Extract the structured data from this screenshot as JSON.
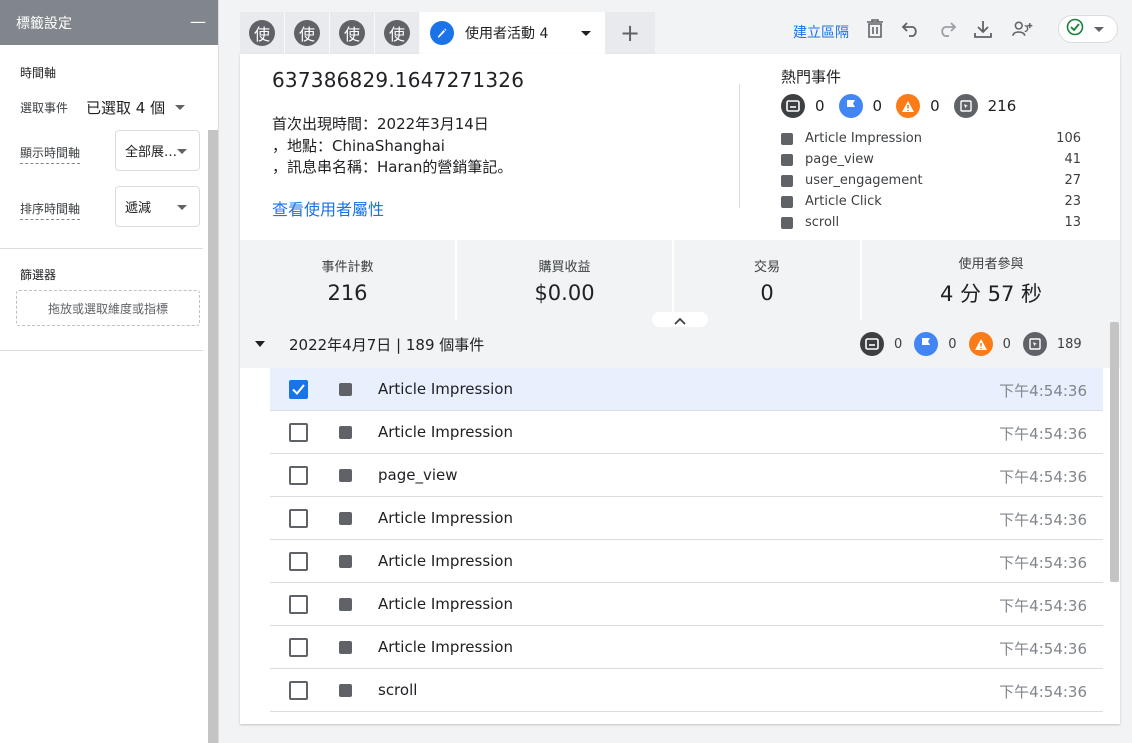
{
  "left_panel": {
    "title": "標籤設定",
    "collapse_symbol": "—",
    "timeline_section": "時間軸",
    "select_event_label": "選取事件",
    "select_event_value": "已選取 4 個",
    "display_timeline_label": "顯示時間軸",
    "display_timeline_value": "全部展…",
    "sort_timeline_label": "排序時間軸",
    "sort_timeline_value": "遞減",
    "filter_section": "篩選器",
    "filter_dropzone": "拖放或選取維度或指標"
  },
  "tabs": {
    "mini": [
      {
        "label": "使"
      },
      {
        "label": "使"
      },
      {
        "label": "使"
      },
      {
        "label": "使"
      }
    ],
    "active_label": "使用者活動 4",
    "add_symbol": "+"
  },
  "toolbar": {
    "create_segment": "建立區隔",
    "icons": [
      "delete-icon",
      "undo-icon",
      "redo-icon",
      "download-icon",
      "share-icon",
      "status-check-icon"
    ]
  },
  "user": {
    "id": "637386829.1647271326",
    "first_seen": "首次出現時間：2022年3月14日",
    "location": "，地點：ChinaShanghai",
    "stream_name": "，訊息串名稱：Haran的營銷筆記。",
    "view_properties": "查看使用者屬性"
  },
  "top_events": {
    "title": "熱門事件",
    "counts": [
      {
        "icon": "conversion-icon",
        "value": "0",
        "color": "#3c4043"
      },
      {
        "icon": "flag-icon",
        "value": "0",
        "color": "#4285f4"
      },
      {
        "icon": "warning-icon",
        "value": "0",
        "color": "#fa7b17"
      },
      {
        "icon": "event-cursor-icon",
        "value": "216",
        "color": "#5f6368"
      }
    ],
    "items": [
      {
        "name": "Article Impression",
        "count": "106"
      },
      {
        "name": "page_view",
        "count": "41"
      },
      {
        "name": "user_engagement",
        "count": "27"
      },
      {
        "name": "Article Click",
        "count": "23"
      },
      {
        "name": "scroll",
        "count": "13"
      }
    ]
  },
  "metrics": [
    {
      "label": "事件計數",
      "value": "216"
    },
    {
      "label": "購買收益",
      "value": "$0.00"
    },
    {
      "label": "交易",
      "value": "0"
    },
    {
      "label": "使用者參與",
      "value": "4 分 57 秒"
    }
  ],
  "day": {
    "title": "2022年4月7日 | 189 個事件",
    "counts": [
      {
        "icon": "conversion-icon",
        "value": "0",
        "color": "#3c4043"
      },
      {
        "icon": "flag-icon",
        "value": "0",
        "color": "#4285f4"
      },
      {
        "icon": "warning-icon",
        "value": "0",
        "color": "#fa7b17"
      },
      {
        "icon": "event-cursor-icon",
        "value": "189",
        "color": "#5f6368"
      }
    ]
  },
  "events": [
    {
      "name": "Article Impression",
      "time": "下午4:54:36",
      "checked": true
    },
    {
      "name": "Article Impression",
      "time": "下午4:54:36",
      "checked": false
    },
    {
      "name": "page_view",
      "time": "下午4:54:36",
      "checked": false
    },
    {
      "name": "Article Impression",
      "time": "下午4:54:36",
      "checked": false
    },
    {
      "name": "Article Impression",
      "time": "下午4:54:36",
      "checked": false
    },
    {
      "name": "Article Impression",
      "time": "下午4:54:36",
      "checked": false
    },
    {
      "name": "Article Impression",
      "time": "下午4:54:36",
      "checked": false
    },
    {
      "name": "scroll",
      "time": "下午4:54:36",
      "checked": false
    }
  ],
  "colors": {
    "accent": "#1a73e8",
    "success": "#188038"
  }
}
